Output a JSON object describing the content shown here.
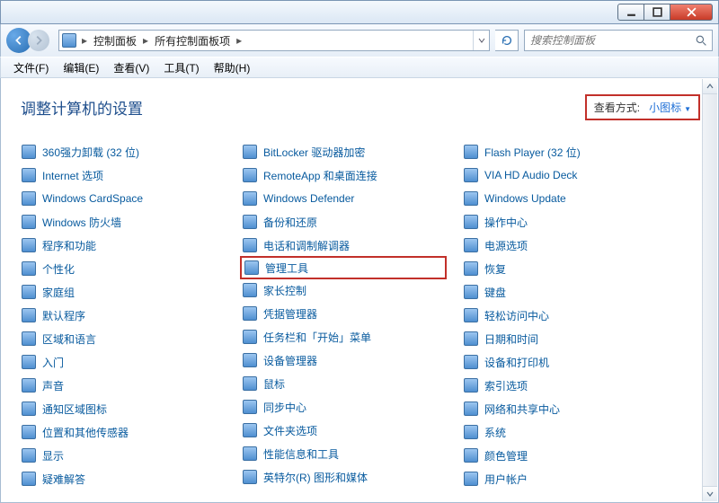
{
  "window": {
    "min_tooltip": "最小化",
    "max_tooltip": "最大化",
    "close_tooltip": "关闭"
  },
  "breadcrumb": {
    "seg1": "控制面板",
    "seg2": "所有控制面板项"
  },
  "search": {
    "placeholder": "搜索控制面板"
  },
  "menu": {
    "file": "文件(F)",
    "edit": "编辑(E)",
    "view": "查看(V)",
    "tools": "工具(T)",
    "help": "帮助(H)"
  },
  "heading": "调整计算机的设置",
  "viewmode": {
    "label": "查看方式:",
    "value": "小图标"
  },
  "cols": [
    [
      "360强力卸载 (32 位)",
      "Internet 选项",
      "Windows CardSpace",
      "Windows 防火墙",
      "程序和功能",
      "个性化",
      "家庭组",
      "默认程序",
      "区域和语言",
      "入门",
      "声音",
      "通知区域图标",
      "位置和其他传感器",
      "显示",
      "疑难解答"
    ],
    [
      "BitLocker 驱动器加密",
      "RemoteApp 和桌面连接",
      "Windows Defender",
      "备份和还原",
      "电话和调制解调器",
      "管理工具",
      "家长控制",
      "凭据管理器",
      "任务栏和「开始」菜单",
      "设备管理器",
      "鼠标",
      "同步中心",
      "文件夹选项",
      "性能信息和工具",
      "英特尔(R) 图形和媒体"
    ],
    [
      "Flash Player (32 位)",
      "VIA HD Audio Deck",
      "Windows Update",
      "操作中心",
      "电源选项",
      "恢复",
      "键盘",
      "轻松访问中心",
      "日期和时间",
      "设备和打印机",
      "索引选项",
      "网络和共享中心",
      "系统",
      "颜色管理",
      "用户帐户"
    ]
  ],
  "highlight": {
    "col": 1,
    "row": 5
  },
  "icon_names": [
    [
      "uninstall-360-icon",
      "internet-options-icon",
      "cardspace-icon",
      "firewall-icon",
      "programs-features-icon",
      "personalization-icon",
      "homegroup-icon",
      "default-programs-icon",
      "region-language-icon",
      "getting-started-icon",
      "sound-icon",
      "notification-area-icon",
      "location-sensors-icon",
      "display-icon",
      "troubleshooting-icon"
    ],
    [
      "bitlocker-icon",
      "remoteapp-icon",
      "defender-icon",
      "backup-restore-icon",
      "phone-modem-icon",
      "admin-tools-icon",
      "parental-controls-icon",
      "credential-manager-icon",
      "taskbar-start-icon",
      "device-manager-icon",
      "mouse-icon",
      "sync-center-icon",
      "folder-options-icon",
      "performance-info-icon",
      "intel-graphics-icon"
    ],
    [
      "flash-player-icon",
      "via-audio-icon",
      "windows-update-icon",
      "action-center-icon",
      "power-options-icon",
      "recovery-icon",
      "keyboard-icon",
      "ease-of-access-icon",
      "date-time-icon",
      "devices-printers-icon",
      "indexing-options-icon",
      "network-sharing-icon",
      "system-icon",
      "color-management-icon",
      "user-accounts-icon"
    ]
  ]
}
